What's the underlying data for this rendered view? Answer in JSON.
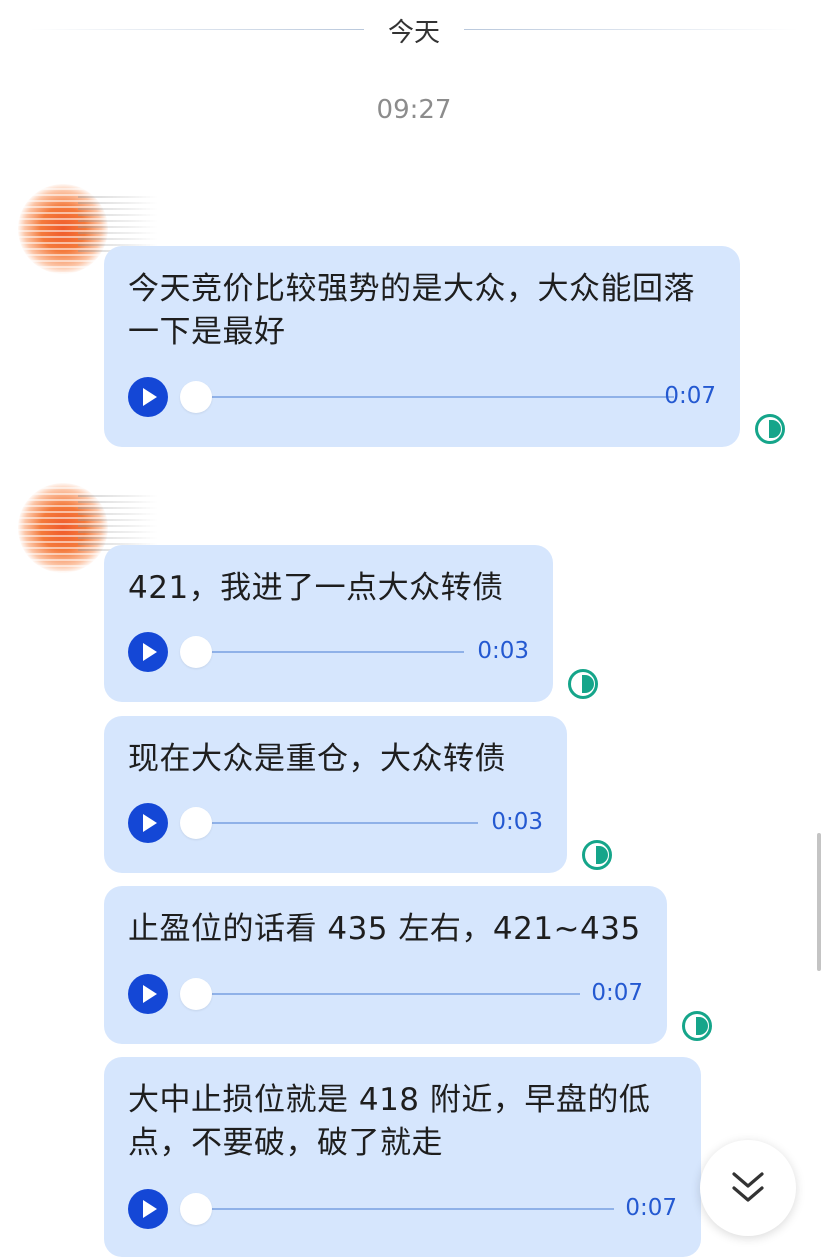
{
  "header": {
    "date": "今天",
    "time": "09:27"
  },
  "colors": {
    "bubble": "#d6e6fd",
    "play": "#1447d6",
    "status": "#15a58a",
    "duration": "#2459d1"
  },
  "icons": {
    "play": "play-icon",
    "status": "read-status-icon",
    "scroll": "chevron-double-down-icon"
  },
  "messages": [
    {
      "text": "今天竞价比较强势的是大众，大众能回落一下是最好",
      "duration": "0:07"
    },
    {
      "text": "421，我进了一点大众转债",
      "duration": "0:03"
    },
    {
      "text": "现在大众是重仓，大众转债",
      "duration": "0:03"
    },
    {
      "text": "止盈位的话看 435 左右，421~435",
      "duration": "0:07"
    },
    {
      "text": "大中止损位就是 418 附近，早盘的低点，不要破，破了就走",
      "duration": "0:07"
    }
  ]
}
